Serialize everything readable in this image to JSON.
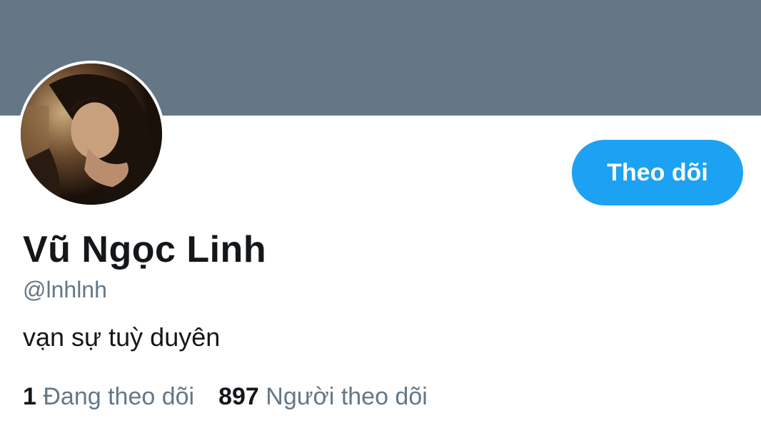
{
  "profile": {
    "display_name": "Vũ Ngọc Linh",
    "handle": "@lnhlnh",
    "bio": "vạn sự tuỳ duyên",
    "follow_label": "Theo dõi"
  },
  "stats": {
    "following_count": "1",
    "following_label": "Đang theo dõi",
    "followers_count": "897",
    "followers_label": "Người theo dõi"
  },
  "colors": {
    "banner": "#657786",
    "accent": "#1da1f2",
    "text_primary": "#14171a",
    "text_secondary": "#657786"
  }
}
